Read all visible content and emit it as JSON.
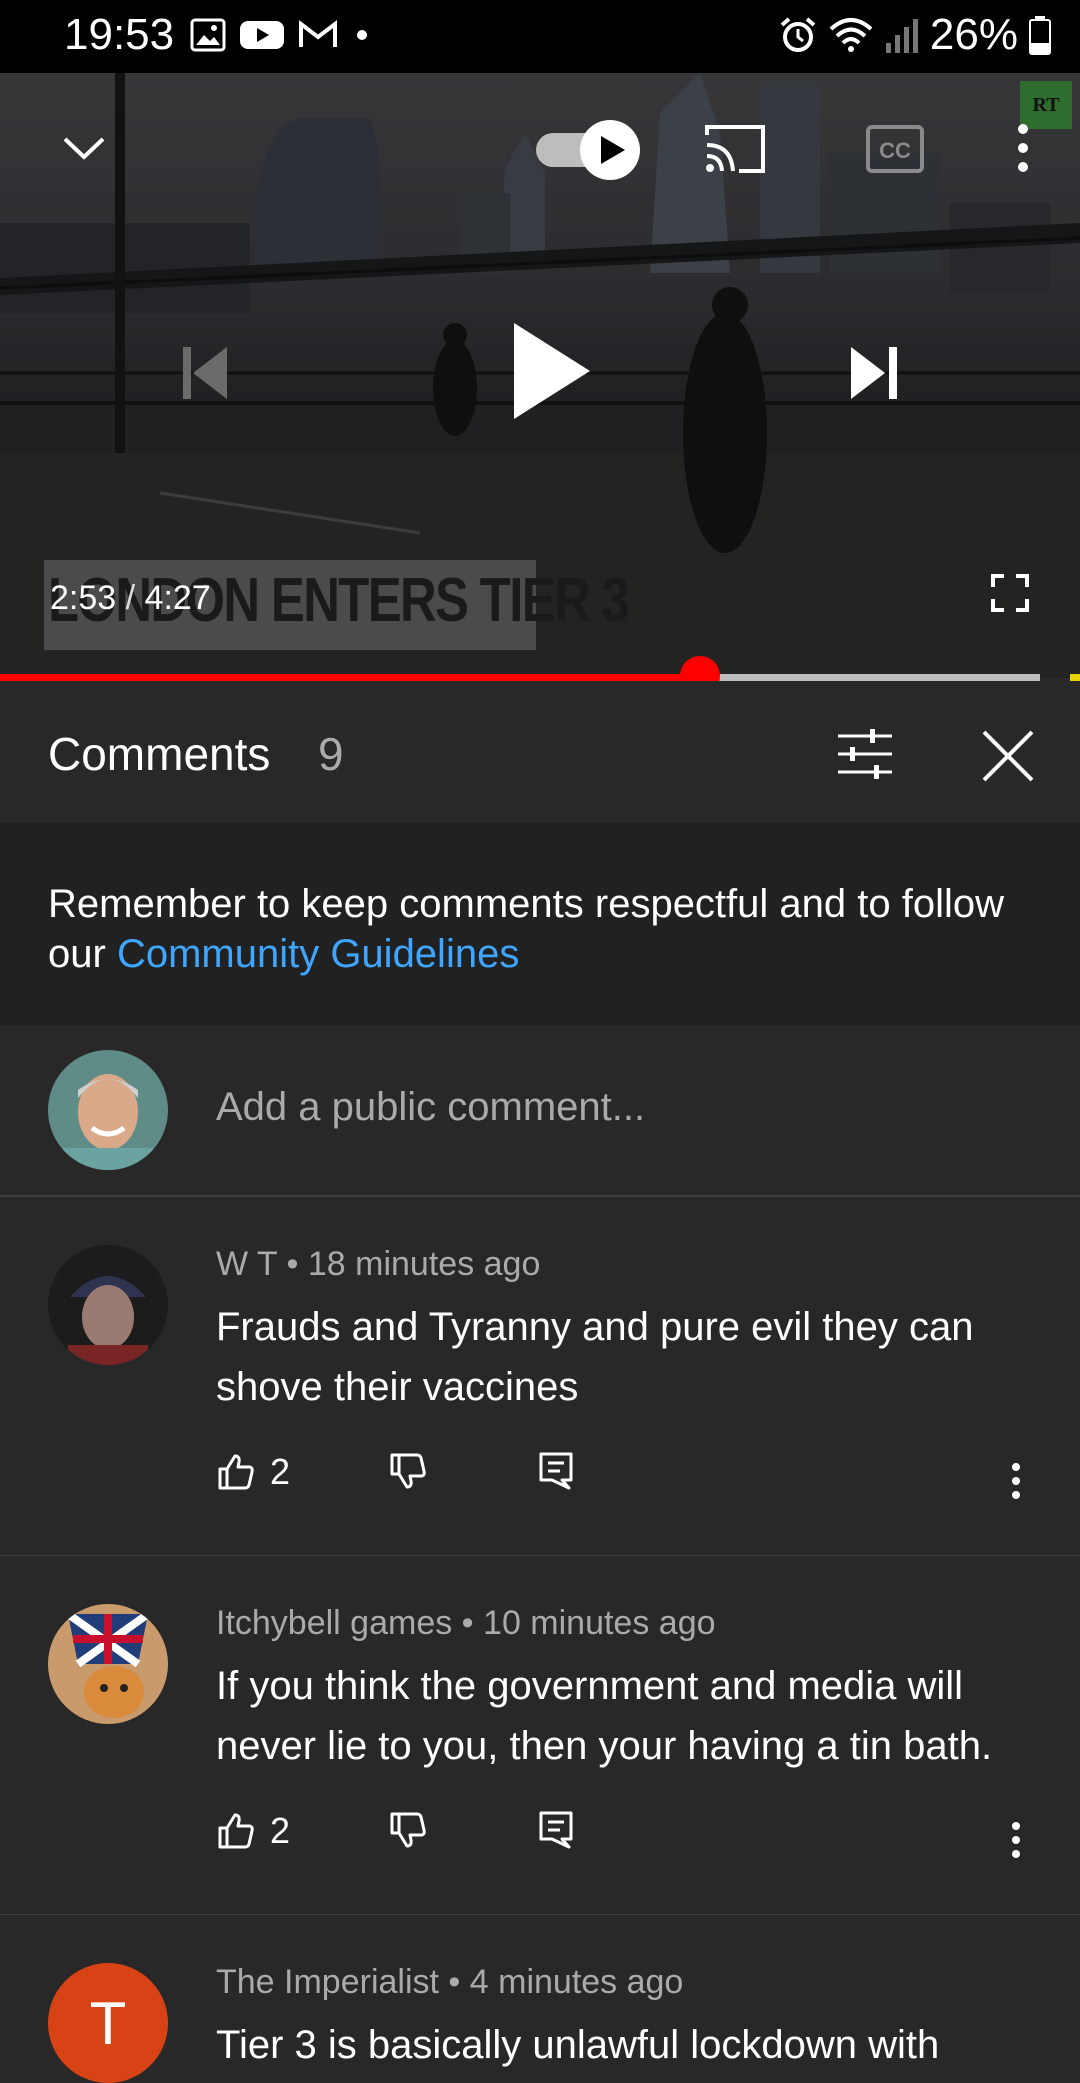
{
  "status_bar": {
    "time": "19:53",
    "battery": "26%"
  },
  "player": {
    "banner_text": "LONDON ENTERS TIER 3",
    "time_current": "2:53",
    "time_separator": " / ",
    "time_total": "4:27",
    "channel_logo": "RT",
    "progress": 0.648,
    "buffered": 0.963,
    "icons": [
      "chevron-down-icon",
      "autoplay-toggle-icon",
      "cast-icon",
      "captions-icon",
      "more-vert-icon",
      "previous-icon",
      "play-icon",
      "next-icon",
      "fullscreen-icon"
    ]
  },
  "comments_header": {
    "title": "Comments",
    "count": "9"
  },
  "notice": {
    "text": "Remember to keep comments respectful and to follow our ",
    "link": "Community Guidelines"
  },
  "add_comment": {
    "placeholder": "Add a public comment..."
  },
  "comments": [
    {
      "author": "W T",
      "time": "18 minutes ago",
      "text": "Frauds and Tyranny and pure evil they can shove their vaccines",
      "likes": "2"
    },
    {
      "author": "Itchybell games",
      "time": "10 minutes ago",
      "text": "If you think the government and media will never lie to you, then your having a tin bath.",
      "likes": "2"
    },
    {
      "author": "The Imperialist",
      "time": "4 minutes ago",
      "text": "Tier 3 is basically unlawful lockdown with",
      "avatar_letter": "T"
    }
  ],
  "colors": {
    "accent_red": "#ff0000",
    "link_blue": "#3ea6ff",
    "avatar_orange": "#d84315"
  }
}
